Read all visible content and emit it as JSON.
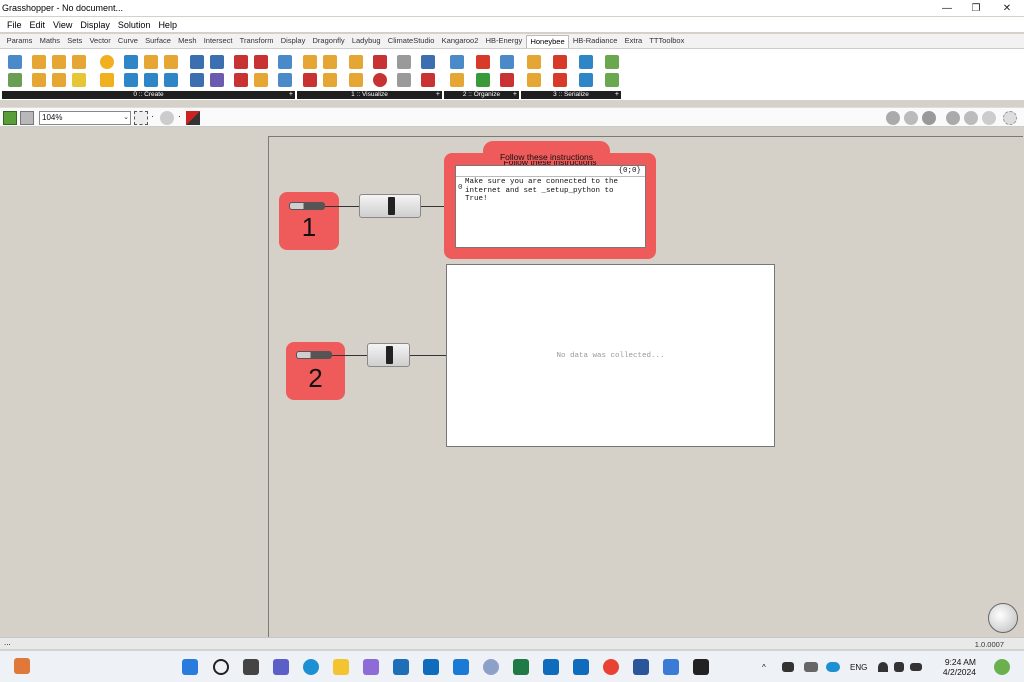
{
  "window": {
    "title": "Grasshopper - No document...",
    "controls": {
      "minimize": "—",
      "restore": "❐",
      "close": "✕"
    }
  },
  "menubar": {
    "items": [
      "File",
      "Edit",
      "View",
      "Display",
      "Solution",
      "Help"
    ]
  },
  "tabs": {
    "items": [
      "Params",
      "Maths",
      "Sets",
      "Vector",
      "Curve",
      "Surface",
      "Mesh",
      "Intersect",
      "Transform",
      "Display",
      "Dragonfly",
      "Ladybug",
      "ClimateStudio",
      "Kangaroo2",
      "HB-Energy",
      "Honeybee",
      "HB-Radiance",
      "Extra",
      "TTToolbox"
    ],
    "active": "Honeybee"
  },
  "ribbon": {
    "groups": [
      {
        "label": "0 :: Create",
        "plus": "+"
      },
      {
        "label": "1 :: Visualize",
        "plus": "+"
      },
      {
        "label": "2 :: Organize",
        "plus": "+"
      },
      {
        "label": "3 :: Serialize",
        "plus": "+"
      }
    ]
  },
  "toolbar": {
    "zoom": "104%",
    "zoom_arrow": "⌄",
    "dot": "·"
  },
  "canvas": {
    "group1": {
      "title": "Follow these instructions",
      "number": "1",
      "panel_header": "{0;0}",
      "panel_index": "0",
      "panel_text": "Make sure you are connected to the\ninternet and set _setup_python to\nTrue!"
    },
    "group2": {
      "number": "2"
    },
    "panel2": {
      "empty_text": "No data was collected..."
    }
  },
  "status": {
    "left": "...",
    "version": "1.0.0007"
  },
  "taskbar": {
    "tray": {
      "chevron": "^",
      "lang": "ENG"
    },
    "clock": {
      "time": "9:24 AM",
      "date": "4/2/2024"
    }
  },
  "colors": {
    "group_red": "#ef5a5a",
    "canvas_bg": "#d5d1c9",
    "ribbon_label_bg": "#1f1f1f",
    "taskbar_bg": "#eef1f6"
  }
}
